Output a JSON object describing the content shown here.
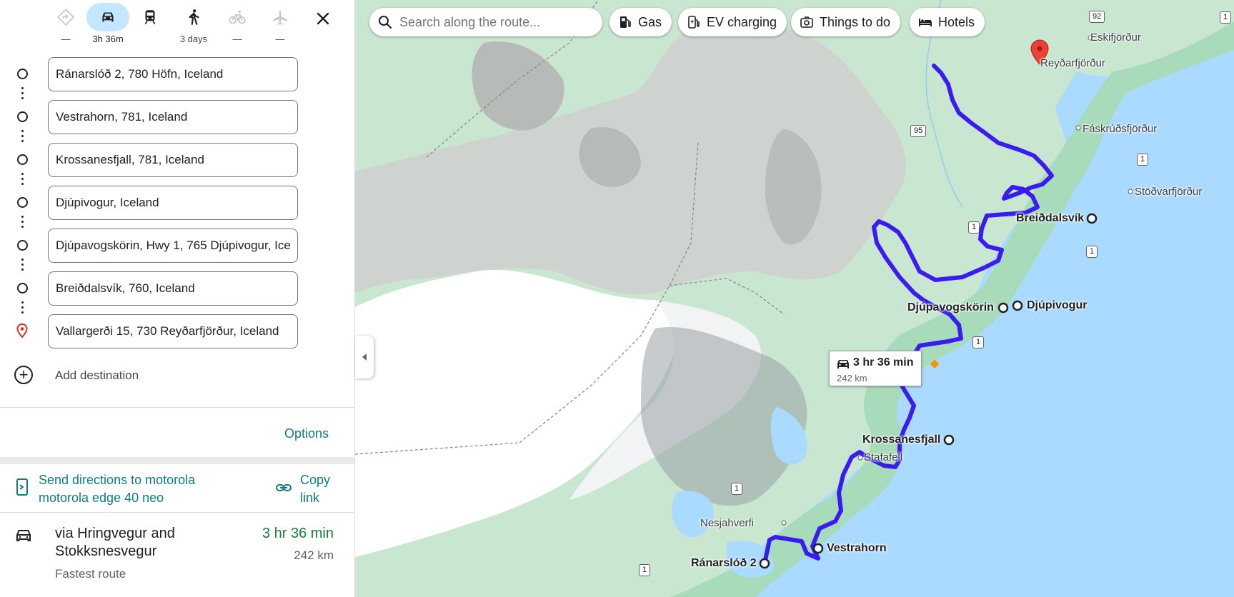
{
  "travel_modes": [
    {
      "name": "best",
      "label": "—"
    },
    {
      "name": "driving",
      "label": "3h 36m"
    },
    {
      "name": "transit",
      "label": ""
    },
    {
      "name": "walking",
      "label": "3 days"
    },
    {
      "name": "cycling",
      "label": "—"
    },
    {
      "name": "flights",
      "label": "—"
    }
  ],
  "stops": [
    "Ránarslóð 2, 780 Höfn, Iceland",
    "Vestrahorn, 781, Iceland",
    "Krossanesfjall, 781, Iceland",
    "Djúpivogur, Iceland",
    "Djúpavogskörin, Hwy 1, 765 Djúpivogur, Iceland",
    "Breiðdalsvík, 760, Iceland",
    "Vallargerði 15, 730 Reyðarfjörður, Iceland"
  ],
  "add_destination": "Add destination",
  "options": "Options",
  "send_directions": "Send directions to motorola motorola edge 40 neo",
  "copy_link": "Copy link",
  "route": {
    "via": "via Hringvegur and Stokksnesvegur",
    "subtitle": "Fastest route",
    "time": "3 hr 36 min",
    "distance": "242 km"
  },
  "map": {
    "search_placeholder": "Search along the route...",
    "chips": [
      "Gas",
      "EV charging",
      "Things to do",
      "Hotels"
    ],
    "eta": {
      "time": "3 hr 36 min",
      "distance": "242 km"
    },
    "stop_labels": [
      "Ránarslóð 2",
      "Vestrahorn",
      "Krossanesfjall",
      "Djúpavogskörin",
      "Djúpivogur",
      "Breiðdalsvík"
    ],
    "place_labels": [
      "Eskifjörður",
      "Reyðarfjörður",
      "Fáskrúðsfjörður",
      "Stöðvarfjörður",
      "Stafafell",
      "Nesjahverfi"
    ],
    "road_shields": [
      "92",
      "95",
      "1",
      "1",
      "1",
      "1",
      "1",
      "1",
      "1"
    ],
    "colors": {
      "route": "#3b1cf0",
      "water": "#aadaff",
      "land": "#c8e6d0",
      "ice": "#ffffff"
    }
  }
}
